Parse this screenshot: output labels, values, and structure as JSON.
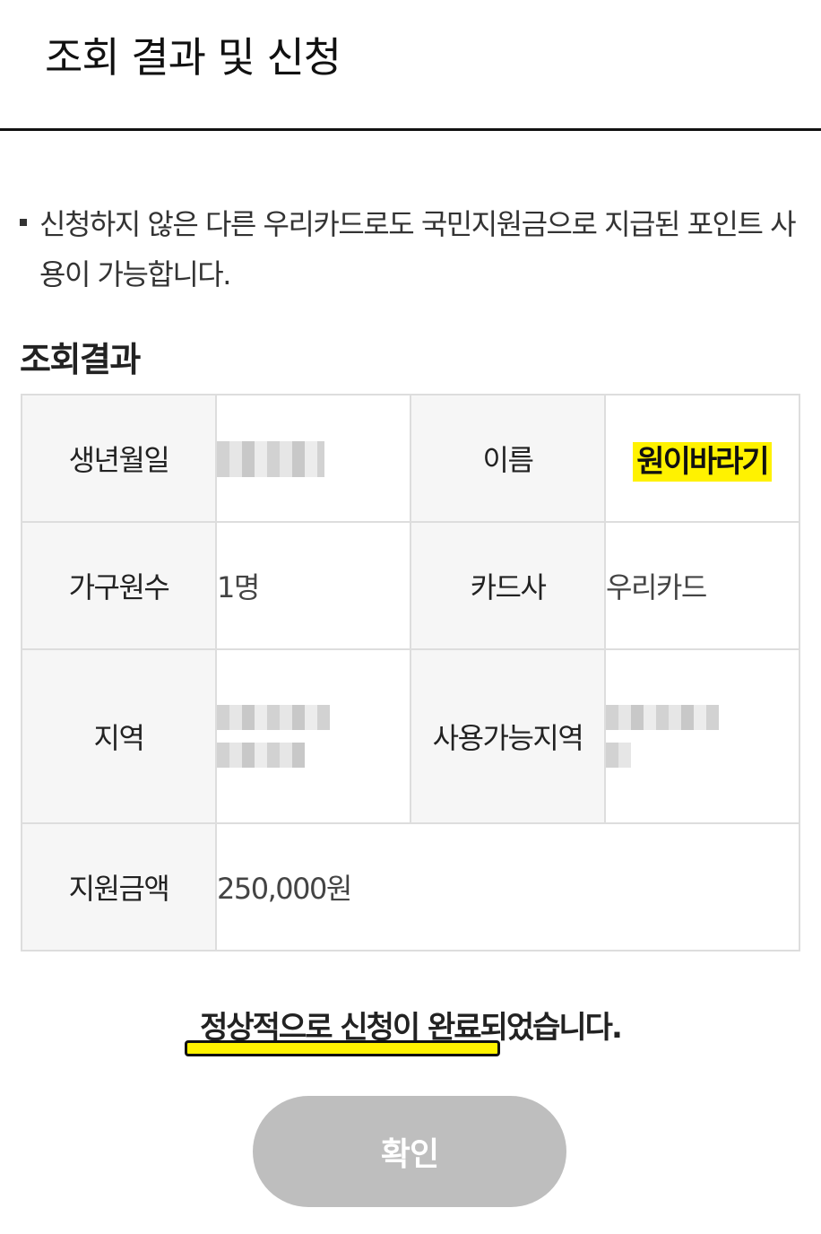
{
  "header": {
    "title": "조회 결과 및 신청"
  },
  "notice": {
    "text": "신청하지 않은 다른 우리카드로도 국민지원금으로 지급된 포인트 사용이 가능합니다."
  },
  "result": {
    "section_title": "조회결과",
    "birth_label": "생년월일",
    "name_label": "이름",
    "name_value": "원이바라기",
    "household_label": "가구원수",
    "household_value": "1명",
    "card_label": "카드사",
    "card_value": "우리카드",
    "region_label": "지역",
    "usable_region_label": "사용가능지역",
    "amount_label": "지원금액",
    "amount_value": "250,000원"
  },
  "status": {
    "message": "정상적으로 신청이 완료되었습니다."
  },
  "actions": {
    "confirm_label": "확인"
  },
  "colors": {
    "highlight": "#fff200",
    "button_bg": "#bebebe",
    "label_bg": "#f6f6f6"
  }
}
